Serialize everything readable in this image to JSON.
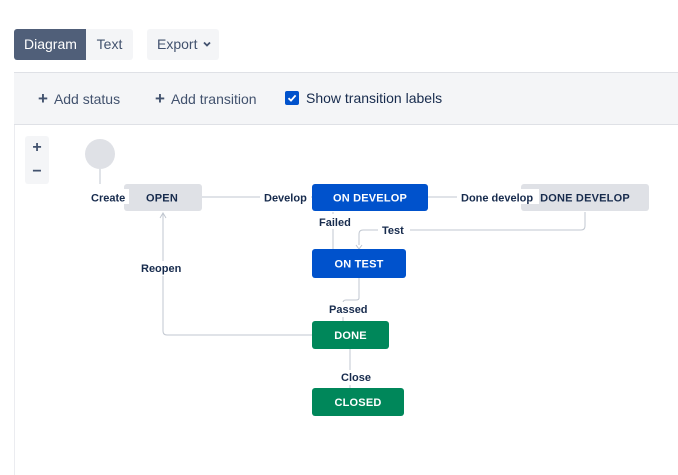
{
  "header": {
    "view_tabs": [
      {
        "label": "Diagram",
        "active": true
      },
      {
        "label": "Text",
        "active": false
      }
    ],
    "export_label": "Export"
  },
  "toolbar": {
    "add_status_label": "Add status",
    "add_transition_label": "Add transition",
    "show_labels_label": "Show transition labels",
    "show_labels_checked": true
  },
  "zoom": {
    "in_label": "+",
    "out_label": "−"
  },
  "workflow": {
    "statuses": {
      "open": "OPEN",
      "on_develop": "ON DEVELOP",
      "done_develop": "DONE DEVELOP",
      "on_test": "ON TEST",
      "done": "DONE",
      "closed": "CLOSED"
    },
    "transitions": {
      "create": "Create",
      "develop": "Develop",
      "done_develop": "Done develop",
      "failed": "Failed",
      "test": "Test",
      "reopen": "Reopen",
      "passed": "Passed",
      "close": "Close"
    }
  },
  "colors": {
    "todo": "#dfe1e6",
    "in_progress": "#0052cc",
    "done": "#00875a",
    "active_tab": "#505f79"
  }
}
